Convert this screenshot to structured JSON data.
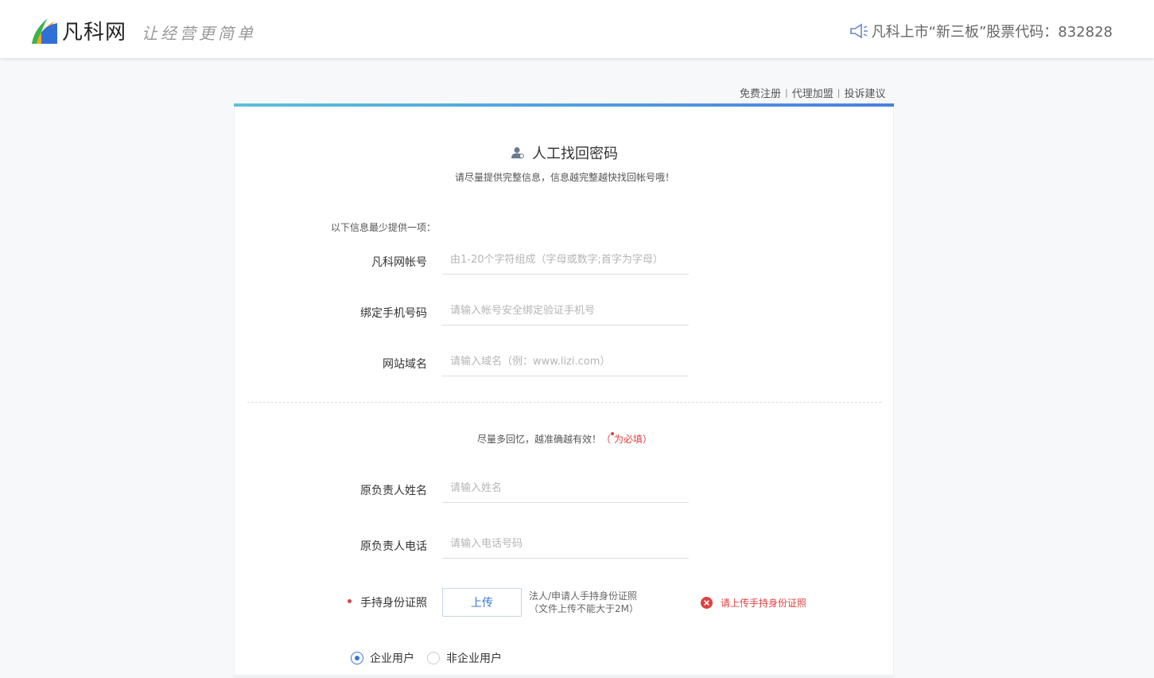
{
  "header": {
    "logo_text": "凡科网",
    "slogan": "让经营更简单",
    "stock_notice": "凡科上市“新三板”股票代码：832828"
  },
  "top_links": {
    "register": "免费注册",
    "agent": "代理加盟",
    "complaint": "投诉建议",
    "separator": "|"
  },
  "form": {
    "title": "人工找回密码",
    "subtitle": "请尽量提供完整信息，信息越完整越快找回帐号哦！",
    "section_note": "以下信息最少提供一项：",
    "account": {
      "label": "凡科网帐号",
      "placeholder": "由1-20个字符组成（字母或数字;首字为字母）"
    },
    "phone": {
      "label": "绑定手机号码",
      "placeholder": "请输入帐号安全绑定验证手机号"
    },
    "domain": {
      "label": "网站域名",
      "placeholder": "请输入域名（例：www.lizi.com）"
    },
    "hint_text": "尽量多回忆，越准确越有效！",
    "hint_open": "（",
    "hint_required": "为必填）",
    "owner_name": {
      "label": "原负责人姓名",
      "placeholder": "请输入姓名"
    },
    "owner_phone": {
      "label": "原负责人电话",
      "placeholder": "请输入电话号码"
    },
    "id_photo": {
      "label": "手持身份证照",
      "button": "上传",
      "tip_line1": "法人/申请人手持身份证照",
      "tip_line2": "（文件上传不能大于2M）",
      "error": "请上传手持身份证照"
    },
    "user_type": {
      "options": [
        "企业用户",
        "非企业用户"
      ],
      "selected": "企业用户"
    }
  },
  "colors": {
    "accent": "#3a78d6",
    "error": "#e04040",
    "progress_green": "#5cc04a"
  }
}
